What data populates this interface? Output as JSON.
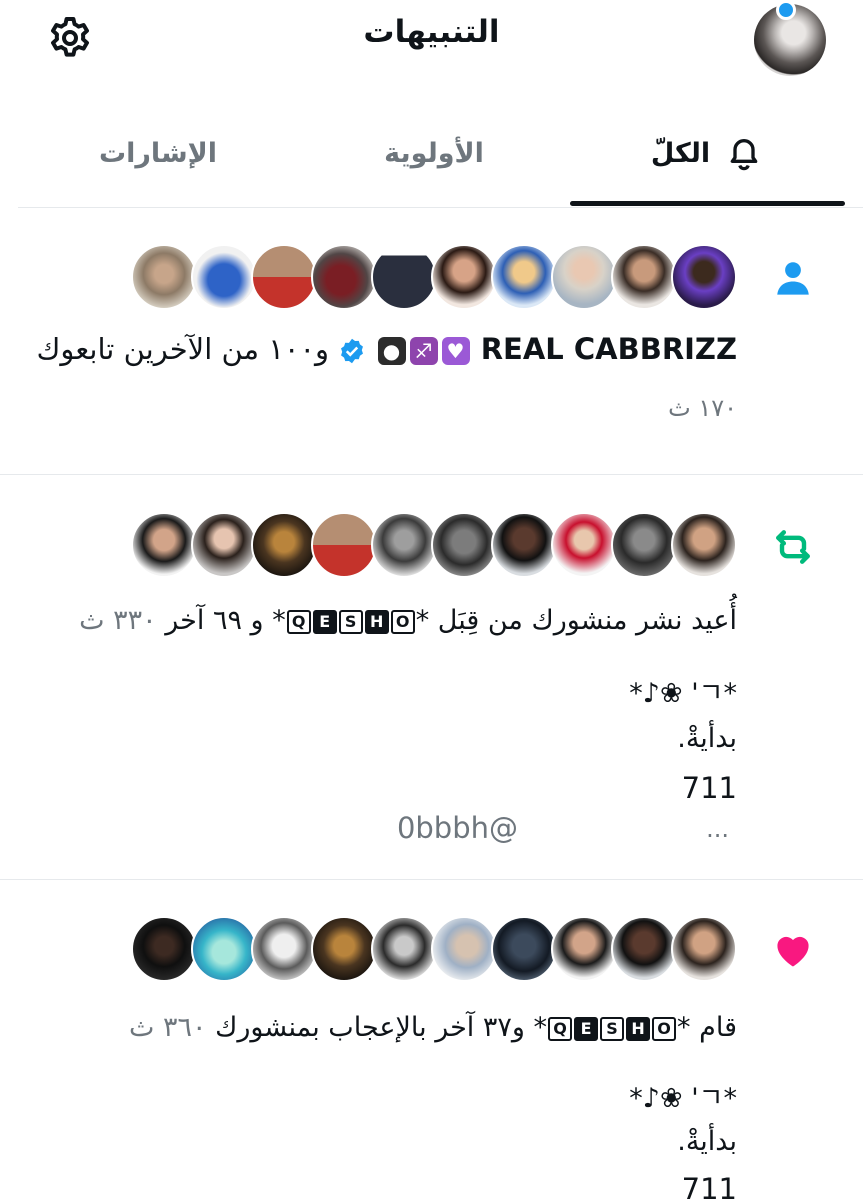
{
  "header": {
    "title": "التنبيهات"
  },
  "tabs": [
    {
      "label": "الكلّ",
      "active": true
    },
    {
      "label": "الأولوية",
      "active": false
    },
    {
      "label": "الإشارات",
      "active": false
    }
  ],
  "notifications": [
    {
      "type": "follow",
      "icon": "person-icon",
      "name": "REAL CABBRIZZ",
      "text": "و١٠٠ من الآخرين تابعوك",
      "time": "١٧٠ ث"
    },
    {
      "type": "repost",
      "icon": "repost-icon",
      "text_prefix": "أُعيد نشر منشورك من قِبَل",
      "name_letters": [
        "Q",
        "E",
        "S",
        "H",
        "O"
      ],
      "text_suffix": "و ٦٩ آخر",
      "time": "٣٣٠ ث",
      "post_lines": [
        "*ㄱ' ❀♪*",
        "بدأيةْ.",
        "711"
      ],
      "handle": "@0bbbh",
      "more": "..."
    },
    {
      "type": "like",
      "icon": "heart-icon",
      "text_prefix": "قام",
      "name_letters": [
        "Q",
        "E",
        "S",
        "H",
        "O"
      ],
      "text_suffix": "و٣٧ آخر بالإعجاب بمنشورك",
      "time": "٣٦٠ ث",
      "post_lines": [
        "*ㄱ' ❀♪*",
        "بدأيةْ.",
        "711"
      ]
    }
  ],
  "colors": {
    "accent": "#1d9bf0",
    "repost": "#00ba7c",
    "like": "#f91880",
    "text": "#0f1419",
    "muted": "#6e767d"
  }
}
